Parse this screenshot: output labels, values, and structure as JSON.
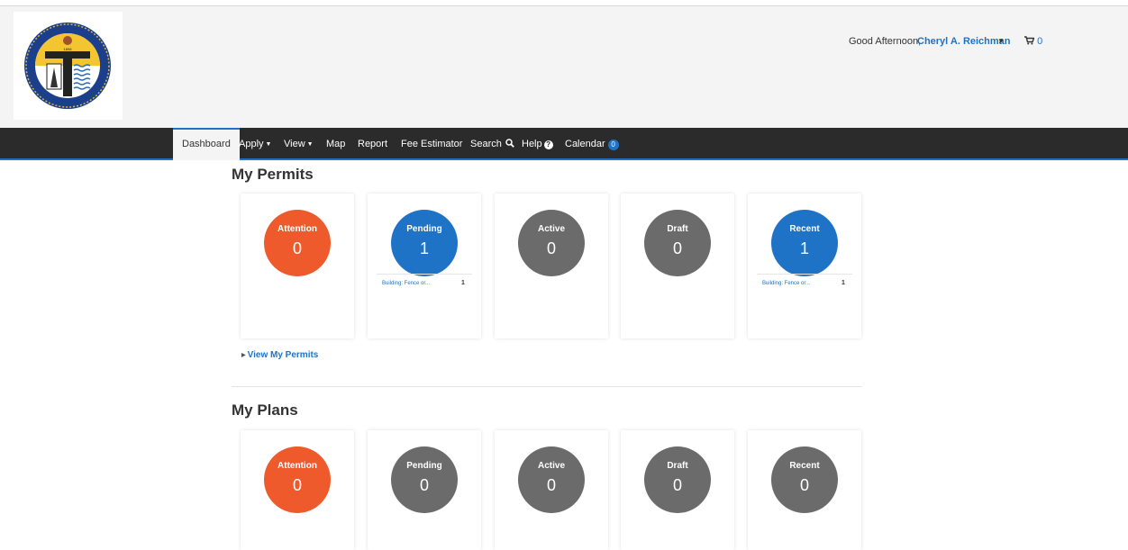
{
  "header": {
    "greeting": "Good Afternoon,",
    "user_name": "Cheryl A. Reichman",
    "cart_count": "0",
    "logo_text": "CITY OF TULSA OKLAHOMA",
    "logo_year": "1898"
  },
  "nav": {
    "dashboard": "Dashboard",
    "apply": "Apply",
    "view": "View",
    "map": "Map",
    "report": "Report",
    "fee_estimator": "Fee Estimator",
    "search": "Search",
    "help": "Help",
    "calendar": "Calendar",
    "calendar_badge": "0"
  },
  "permits": {
    "title": "My Permits",
    "cards": [
      {
        "label": "Attention",
        "count": "0",
        "color": "#ef5a2c"
      },
      {
        "label": "Pending",
        "count": "1",
        "color": "#1f73c6",
        "link": "Building: Fence or...",
        "link_count": "1"
      },
      {
        "label": "Active",
        "count": "0",
        "color": "#6b6b6b"
      },
      {
        "label": "Draft",
        "count": "0",
        "color": "#6b6b6b"
      },
      {
        "label": "Recent",
        "count": "1",
        "color": "#1f73c6",
        "link": "Building: Fence or...",
        "link_count": "1"
      }
    ],
    "view_link": "View My Permits"
  },
  "plans": {
    "title": "My Plans",
    "cards": [
      {
        "label": "Attention",
        "count": "0",
        "color": "#ef5a2c"
      },
      {
        "label": "Pending",
        "count": "0",
        "color": "#6b6b6b"
      },
      {
        "label": "Active",
        "count": "0",
        "color": "#6b6b6b"
      },
      {
        "label": "Draft",
        "count": "0",
        "color": "#6b6b6b"
      },
      {
        "label": "Recent",
        "count": "0",
        "color": "#6b6b6b"
      }
    ]
  },
  "colors": {
    "accent": "#1f73c6",
    "attention": "#ef5a2c",
    "inactive": "#6b6b6b",
    "navbar": "#2b2b2b"
  }
}
